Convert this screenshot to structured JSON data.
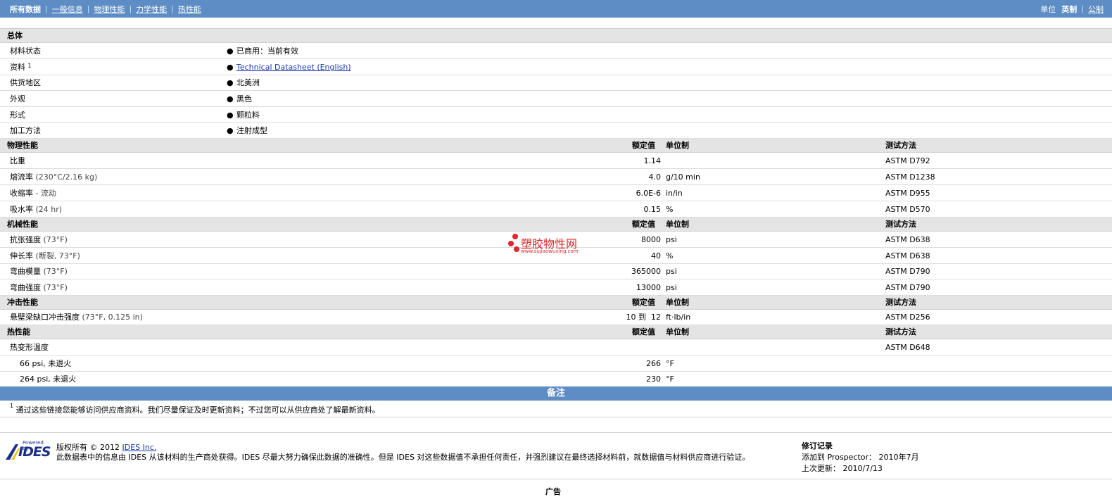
{
  "nav": {
    "all": "所有数据",
    "general": "一般信息",
    "physical": "物理性能",
    "mechanical": "力学性能",
    "thermal": "热性能",
    "units_label": "单位",
    "units_current": "英制",
    "units_other": "公制"
  },
  "general": {
    "title": "总体",
    "rows": [
      {
        "label": "材料状态",
        "value": "已商用：当前有效"
      },
      {
        "label": "资料",
        "sup": "1",
        "value": "Technical Datasheet (English)"
      },
      {
        "label": "供货地区",
        "value": "北美洲"
      },
      {
        "label": "外观",
        "value": "黑色"
      },
      {
        "label": "形式",
        "value": "颗粒料"
      },
      {
        "label": "加工方法",
        "value": "注射成型"
      }
    ]
  },
  "headers": {
    "rated": "额定值",
    "unit": "单位制",
    "method": "测试方法"
  },
  "physical": {
    "title": "物理性能",
    "rows": [
      {
        "label": "比重",
        "cond": "",
        "value": "1.14",
        "unit": "",
        "method": "ASTM D792"
      },
      {
        "label": "熔流率",
        "cond": "(230°C/2.16 kg)",
        "value": "4.0",
        "unit": "g/10 min",
        "method": "ASTM D1238"
      },
      {
        "label": "收缩率",
        "cond": "- 流动",
        "value": "6.0E-6",
        "unit": "in/in",
        "method": "ASTM D955"
      },
      {
        "label": "吸水率",
        "cond": "(24 hr)",
        "value": "0.15",
        "unit": "%",
        "method": "ASTM D570"
      }
    ]
  },
  "mechanical": {
    "title": "机械性能",
    "rows": [
      {
        "label": "抗张强度",
        "cond": "(73°F)",
        "value": "8000",
        "unit": "psi",
        "method": "ASTM D638"
      },
      {
        "label": "伸长率",
        "cond": "(断裂, 73°F)",
        "value": "40",
        "unit": "%",
        "method": "ASTM D638"
      },
      {
        "label": "弯曲模量",
        "cond": "(73°F)",
        "value": "365000",
        "unit": "psi",
        "method": "ASTM D790"
      },
      {
        "label": "弯曲强度",
        "cond": "(73°F)",
        "value": "13000",
        "unit": "psi",
        "method": "ASTM D790"
      }
    ]
  },
  "impact": {
    "title": "冲击性能",
    "rows": [
      {
        "label": "悬壁梁缺口冲击强度",
        "cond": "(73°F, 0.125 in)",
        "value": "10 到  12",
        "unit": "ft·lb/in",
        "method": "ASTM D256"
      }
    ]
  },
  "thermal": {
    "title": "热性能",
    "main_label": "热变形温度",
    "main_method": "ASTM D648",
    "rows": [
      {
        "label": "66 psi, 未退火",
        "value": "266",
        "unit": "°F"
      },
      {
        "label": "264 psi, 未退火",
        "value": "230",
        "unit": "°F"
      }
    ]
  },
  "notes": {
    "title": "备注",
    "sup": "1",
    "text": "通过这些链接您能够访问供应商资料。我们尽量保证及时更新资料；不过您可以从供应商处了解最新资料。"
  },
  "watermark": {
    "cn": "塑胶物性网",
    "en": "www.sujiaowuxing.com"
  },
  "footer": {
    "logo_powered": "Powered by",
    "logo_word": "IDES",
    "copyright_prefix": "版权所有 © 2012",
    "copyright_link": "IDES Inc.",
    "disclaimer": "此数据表中的信息由  IDES 从该材料的生产商处获得。IDES 尽最大努力确保此数据的准确性。但是  IDES 对这些数据值不承担任何责任，并强烈建议在最终选择材料前，就数据值与材料供应商进行验证。",
    "rev_title": "修订记录",
    "rev_added": "添加到 Prospector： 2010年7月",
    "rev_updated": "上次更新： 2010/7/13",
    "ads": "广告"
  }
}
